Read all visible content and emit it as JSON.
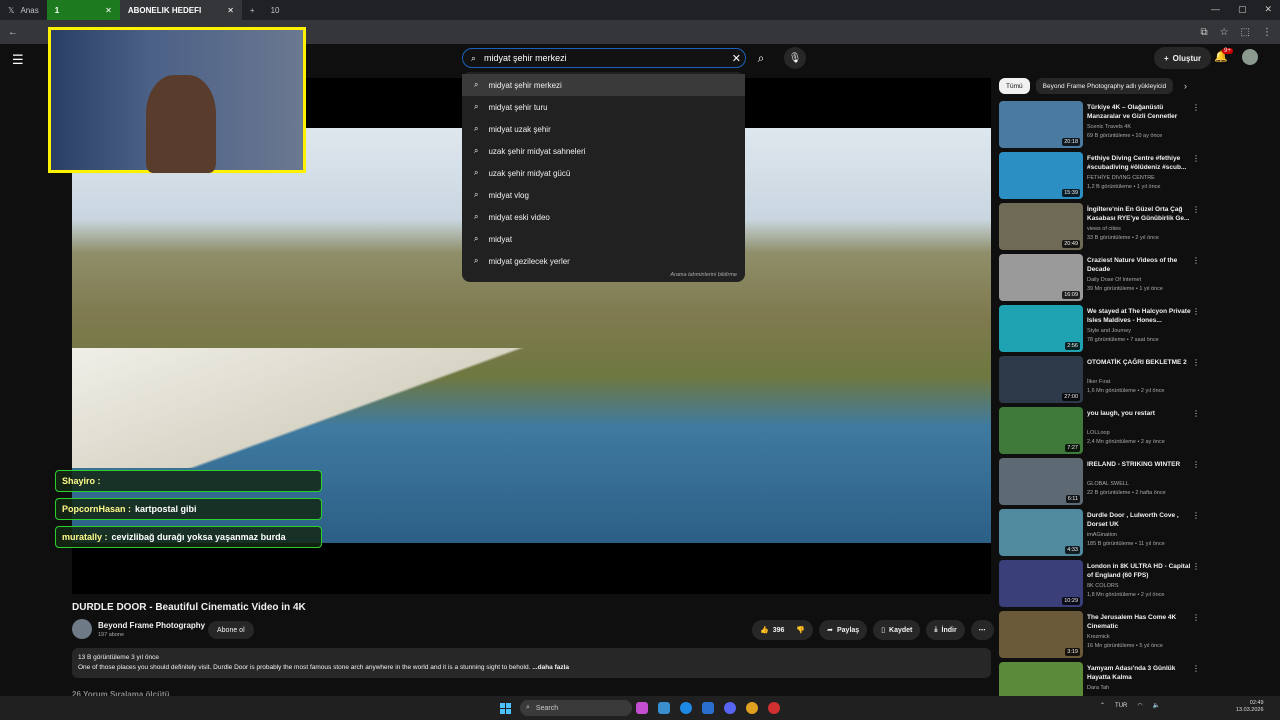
{
  "browser": {
    "tabs": [
      {
        "label": "Anas"
      },
      {
        "label": "1"
      },
      {
        "label": "ABONELIK HEDEFI"
      },
      {
        "label": "10"
      }
    ]
  },
  "search": {
    "query": "midyat şehir merkezi",
    "suggestions": [
      "midyat şehir merkezi",
      "midyat şehir turu",
      "midyat uzak şehir",
      "uzak şehir midyat sahneleri",
      "uzak şehir midyat gücü",
      "midyat vlog",
      "midyat eski video",
      "midyat",
      "midyat gezilecek yerler"
    ],
    "footer": "Arama tahminlerini bildirme"
  },
  "header": {
    "create_label": "Oluştur",
    "notif_count": "9+"
  },
  "stream_chat": [
    {
      "user": "Shayiro :",
      "msg": ""
    },
    {
      "user": "PopcornHasan :",
      "msg": "kartpostal gibi"
    },
    {
      "user": "muratally :",
      "msg": "cevizlibağ durağı yoksa yaşanmaz burda"
    }
  ],
  "video": {
    "title": "DURDLE DOOR - Beautiful Cinematic Video in 4K",
    "channel": "Beyond Frame Photography",
    "subscribers": "197 abone",
    "subscribe_label": "Abone ol",
    "likes": "396",
    "share_label": "Paylaş",
    "save_label": "Kaydet",
    "download_label": "İndir",
    "views_date": "13 B görüntüleme  3 yıl önce",
    "description": "One of those places you should definitely visit. Durdle Door is probably the most famous stone arch anywhere in the world and it is a stunning sight to behold.",
    "more_label": "...daha fazla",
    "comments_label": "26 Yorum    Sıralama ölçütü"
  },
  "chips": [
    "Tümü",
    "Beyond Frame Photography adlı yükleyicid"
  ],
  "recommendations": [
    {
      "title": "Türkiye 4K – Olağanüstü Manzaralar ve Gizli Cennetler",
      "channel": "Scenic Travels 4K",
      "meta": "69 B görüntüleme • 10 ay önce",
      "duration": "20:18",
      "color": "#4a7aa0"
    },
    {
      "title": "Fethiye Diving Centre #fethiye #scubadiving #ölüdeniz #scub...",
      "channel": "FETHİYE DIVING CENTRE",
      "meta": "1,2 B görüntüleme • 1 yıl önce",
      "duration": "15:39",
      "color": "#2c8fc4"
    },
    {
      "title": "İngiltere'nin En Güzel Orta Çağ Kasabası RYE'ye Günübirlik Ge...",
      "channel": "views of cities",
      "meta": "33 B görüntüleme • 2 yıl önce",
      "duration": "20:49",
      "color": "#6e6a55"
    },
    {
      "title": "Craziest Nature Videos of the Decade",
      "channel": "Daily Dose Of Internet",
      "meta": "39 Mn görüntüleme • 1 yıl önce",
      "duration": "16:09",
      "color": "#9a9a9a"
    },
    {
      "title": "We stayed at The Halcyon Private Isles Maldives - Hones...",
      "channel": "Style and Journey",
      "meta": "78 görüntüleme • 7 saat önce",
      "duration": "2:56",
      "color": "#1fa3b3"
    },
    {
      "title": "OTOMATİK ÇAĞRI BEKLETME 2",
      "channel": "İlker Fırat",
      "meta": "1,6 Mn görüntüleme • 2 yıl önce",
      "duration": "27:00",
      "color": "#2e3a4a"
    },
    {
      "title": "you laugh, you restart",
      "channel": "LOLLoop",
      "meta": "2,4 Mn görüntüleme • 2 ay önce",
      "duration": "7:27",
      "color": "#3f7a3a"
    },
    {
      "title": "IRELAND - STRIKING WINTER",
      "channel": "GLOBAL SWELL",
      "meta": "22 B görüntüleme • 2 hafta önce",
      "duration": "6:11",
      "color": "#5d6a73"
    },
    {
      "title": "Durdle Door , Lulworth Cove , Dorset UK",
      "channel": "imAGination",
      "meta": "185 B görüntüleme • 11 yıl önce",
      "duration": "4:33",
      "color": "#4f8a9e"
    },
    {
      "title": "London in 8K ULTRA HD - Capital of England (60 FPS)",
      "channel": "8K COLORS",
      "meta": "1,8 Mn görüntüleme • 2 yıl önce",
      "duration": "10:29",
      "color": "#3a3f7a"
    },
    {
      "title": "The Jerusalem Has Come 4K Cinematic",
      "channel": "Krezmick",
      "meta": "16 Mn görüntüleme • 5 yıl önce",
      "duration": "3:19",
      "color": "#6a5a3a"
    },
    {
      "title": "Yamyam Adası'nda 3 Günlük Hayatta Kalma",
      "channel": "Dara Tah",
      "meta": "",
      "duration": "",
      "color": "#5a8a3a"
    }
  ],
  "taskbar": {
    "search_placeholder": "Search",
    "lang": "TUR",
    "time": "02:49",
    "date": "13.03.2026"
  }
}
